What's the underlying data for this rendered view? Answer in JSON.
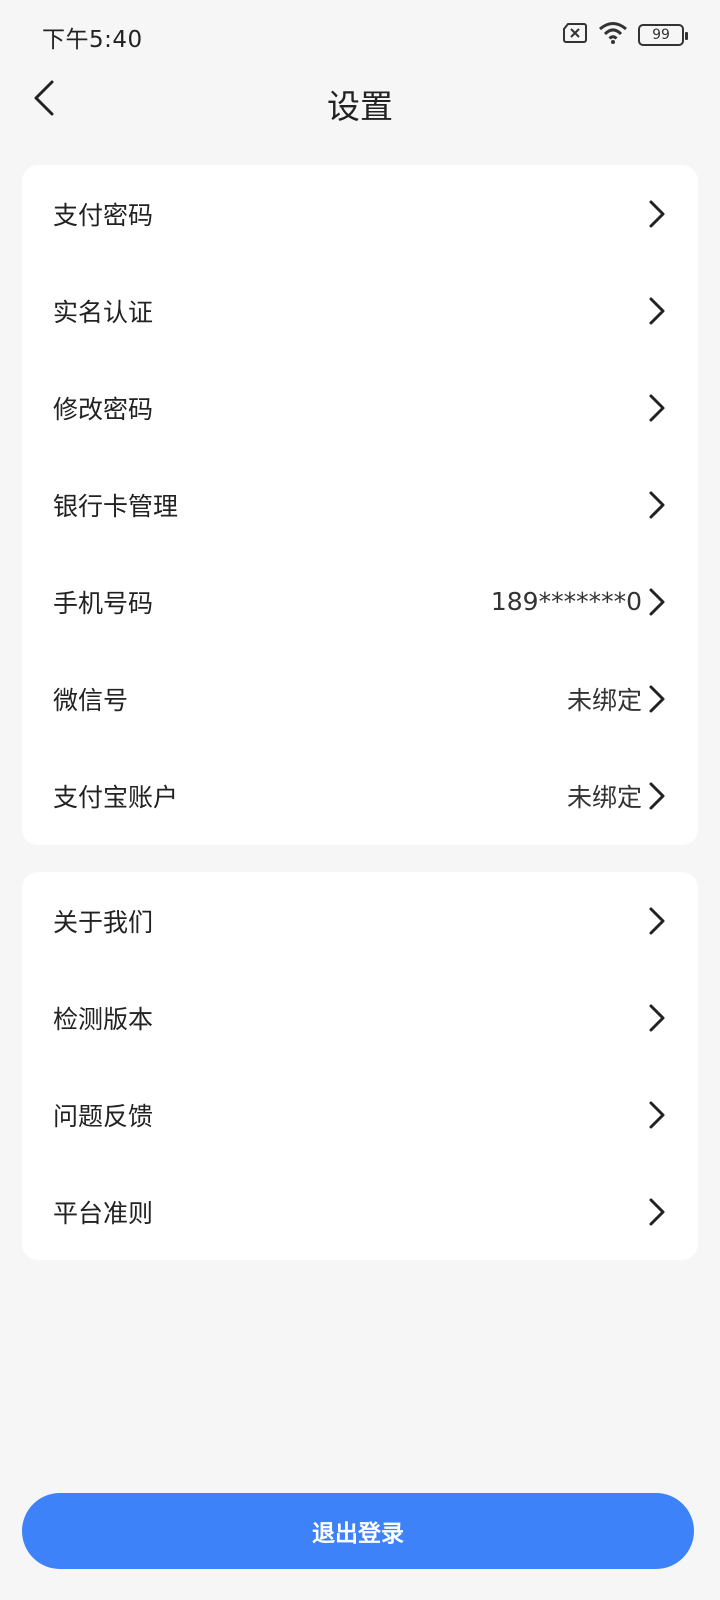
{
  "status_bar": {
    "time": "下午5:40",
    "battery": "99",
    "icons": [
      "sim-error-icon",
      "wifi-icon",
      "battery-icon"
    ]
  },
  "nav": {
    "title": "设置",
    "back_icon": "chevron-left-icon"
  },
  "group1": {
    "items": [
      {
        "label": "支付密码",
        "value": ""
      },
      {
        "label": "实名认证",
        "value": ""
      },
      {
        "label": "修改密码",
        "value": ""
      },
      {
        "label": "银行卡管理",
        "value": ""
      },
      {
        "label": "手机号码",
        "value": "189*******0"
      },
      {
        "label": "微信号",
        "value": "未绑定"
      },
      {
        "label": "支付宝账户",
        "value": "未绑定"
      }
    ]
  },
  "group2": {
    "items": [
      {
        "label": "关于我们",
        "value": ""
      },
      {
        "label": "检测版本",
        "value": ""
      },
      {
        "label": "问题反馈",
        "value": ""
      },
      {
        "label": "平台准则",
        "value": ""
      }
    ]
  },
  "logout": {
    "label": "退出登录",
    "color": "#3d82f8"
  }
}
